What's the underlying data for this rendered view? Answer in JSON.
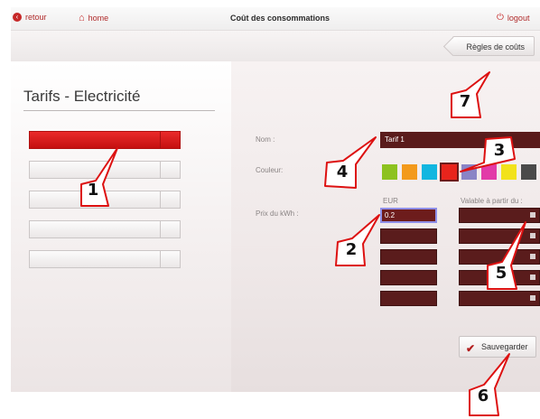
{
  "topbar": {
    "back_label": "retour",
    "home_label": "home",
    "title": "Coût des consommations",
    "logout_label": "logout"
  },
  "rules_button": "Règles de coûts",
  "page_title": "Tarifs - Electricité",
  "tariff_rows": [
    {
      "active": true
    },
    {
      "active": false
    },
    {
      "active": false
    },
    {
      "active": false
    },
    {
      "active": false
    }
  ],
  "form": {
    "name_label": "Nom :",
    "name_value": "Tarif 1",
    "color_label": "Couleur:",
    "price_label": "Prix du kWh :",
    "currency_header": "EUR",
    "valid_from_header": "Valable à partir du :",
    "first_price_value": "0.2"
  },
  "colors": [
    "#8dc21f",
    "#f39a1b",
    "#12b6e0",
    "#e8241c",
    "#8a84c6",
    "#e23aa8",
    "#f2e21b",
    "#4a4a4a"
  ],
  "selected_color_index": 3,
  "save_label": "Sauvegarder",
  "callouts": [
    "1",
    "2",
    "3",
    "4",
    "5",
    "6",
    "7"
  ]
}
